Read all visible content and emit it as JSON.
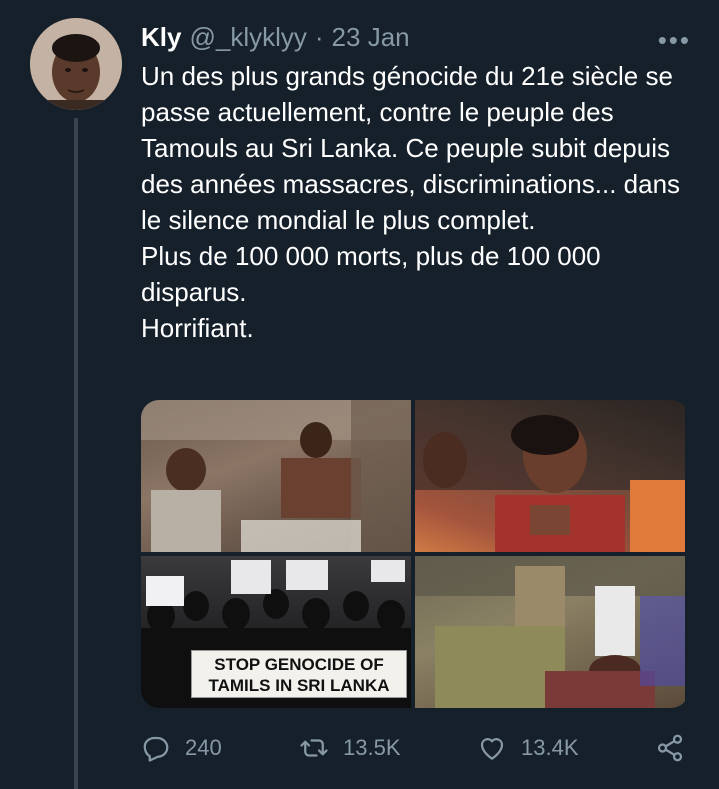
{
  "tweet": {
    "author_name": "Kly",
    "author_handle": "@_klyklyy",
    "separator": "·",
    "date": "23 Jan",
    "more_label": "•••",
    "text_lines": [
      "Un des plus grands génocide du 21e siècle se passe actuellement, contre le peuple des Tamouls au Sri Lanka. Ce peuple subit depuis des années massacres, discriminations... dans le silence mondial le plus complet.",
      "Plus de 100 000 morts, plus de 100 000 disparus.",
      "Horrifiant."
    ],
    "media": {
      "banner_text_line1": "STOP GENOCIDE OF",
      "banner_text_line2": "TAMILS IN SRI LANKA"
    },
    "actions": {
      "replies": "240",
      "retweets": "13.5K",
      "likes": "13.4K"
    }
  },
  "colors": {
    "background": "#15202b",
    "text_primary": "#ffffff",
    "text_secondary": "#8899a6",
    "thread_line": "#38444d"
  },
  "icons": [
    "reply-icon",
    "retweet-icon",
    "like-icon",
    "share-icon",
    "more-icon"
  ]
}
